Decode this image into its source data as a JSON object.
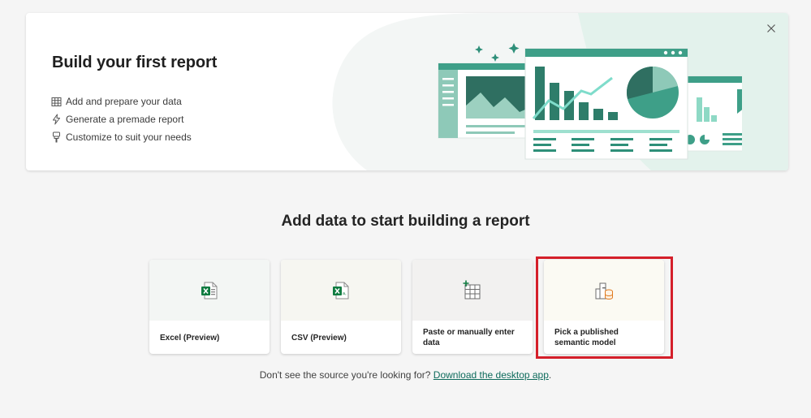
{
  "hero": {
    "title": "Build your first report",
    "close_icon": "close-icon",
    "features": [
      {
        "icon": "table-icon",
        "label": "Add and prepare your data"
      },
      {
        "icon": "lightning-icon",
        "label": "Generate a premade report"
      },
      {
        "icon": "paintbrush-icon",
        "label": "Customize to suit your needs"
      }
    ]
  },
  "main": {
    "title": "Add data to start building a report",
    "cards": [
      {
        "icon": "excel-file-icon",
        "label": "Excel (Preview)"
      },
      {
        "icon": "csv-file-icon",
        "label": "CSV (Preview)"
      },
      {
        "icon": "table-add-icon",
        "label": "Paste or manually enter data"
      },
      {
        "icon": "semantic-model-icon",
        "label": "Pick a published semantic model"
      }
    ]
  },
  "footer": {
    "text": "Don't see the source you're looking for?",
    "link": "Download the desktop app",
    "suffix": "."
  },
  "colors": {
    "accent": "#2e9e85",
    "accent_dark": "#1e7a66",
    "highlight": "#d41f2a",
    "link": "#0e6b5c"
  }
}
